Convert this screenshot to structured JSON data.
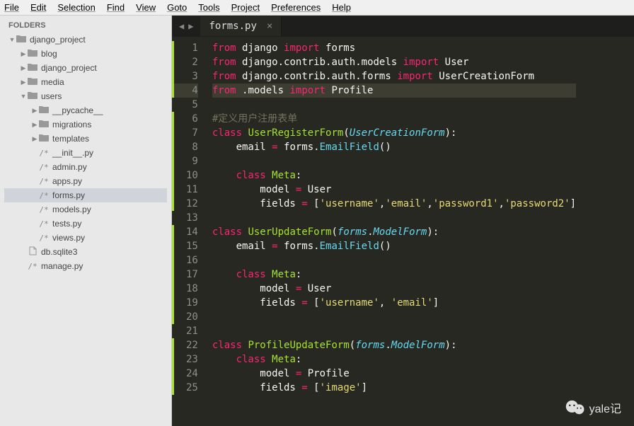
{
  "menubar": [
    "File",
    "Edit",
    "Selection",
    "Find",
    "View",
    "Goto",
    "Tools",
    "Project",
    "Preferences",
    "Help"
  ],
  "sidebar": {
    "title": "FOLDERS",
    "tree": [
      {
        "depth": 0,
        "arrow": "▼",
        "icon": "folder",
        "name": "django_project"
      },
      {
        "depth": 1,
        "arrow": "▶",
        "icon": "folder",
        "name": "blog"
      },
      {
        "depth": 1,
        "arrow": "▶",
        "icon": "folder",
        "name": "django_project"
      },
      {
        "depth": 1,
        "arrow": "▶",
        "icon": "folder",
        "name": "media"
      },
      {
        "depth": 1,
        "arrow": "▼",
        "icon": "folder",
        "name": "users"
      },
      {
        "depth": 2,
        "arrow": "▶",
        "icon": "folder",
        "name": "__pycache__"
      },
      {
        "depth": 2,
        "arrow": "▶",
        "icon": "folder",
        "name": "migrations"
      },
      {
        "depth": 2,
        "arrow": "▶",
        "icon": "folder",
        "name": "templates"
      },
      {
        "depth": 2,
        "arrow": "",
        "icon": "py",
        "name": "__init__.py"
      },
      {
        "depth": 2,
        "arrow": "",
        "icon": "py",
        "name": "admin.py"
      },
      {
        "depth": 2,
        "arrow": "",
        "icon": "py",
        "name": "apps.py"
      },
      {
        "depth": 2,
        "arrow": "",
        "icon": "py",
        "name": "forms.py",
        "selected": true
      },
      {
        "depth": 2,
        "arrow": "",
        "icon": "py",
        "name": "models.py"
      },
      {
        "depth": 2,
        "arrow": "",
        "icon": "py",
        "name": "tests.py"
      },
      {
        "depth": 2,
        "arrow": "",
        "icon": "py",
        "name": "views.py"
      },
      {
        "depth": 1,
        "arrow": "",
        "icon": "file",
        "name": "db.sqlite3"
      },
      {
        "depth": 1,
        "arrow": "",
        "icon": "py",
        "name": "manage.py"
      }
    ]
  },
  "tab": {
    "name": "forms.py",
    "close": "×"
  },
  "nav": {
    "prev": "◀",
    "next": "▶"
  },
  "code": {
    "active_line": 4,
    "lines": [
      {
        "n": 1,
        "mod": true,
        "tokens": [
          [
            "kw",
            "from"
          ],
          [
            "var",
            " django "
          ],
          [
            "kw",
            "import"
          ],
          [
            "var",
            " forms"
          ]
        ]
      },
      {
        "n": 2,
        "mod": true,
        "tokens": [
          [
            "kw",
            "from"
          ],
          [
            "var",
            " django"
          ],
          [
            "pun",
            "."
          ],
          [
            "var",
            "contrib"
          ],
          [
            "pun",
            "."
          ],
          [
            "var",
            "auth"
          ],
          [
            "pun",
            "."
          ],
          [
            "var",
            "models "
          ],
          [
            "kw",
            "import"
          ],
          [
            "var",
            " User"
          ]
        ]
      },
      {
        "n": 3,
        "mod": true,
        "tokens": [
          [
            "kw",
            "from"
          ],
          [
            "var",
            " django"
          ],
          [
            "pun",
            "."
          ],
          [
            "var",
            "contrib"
          ],
          [
            "pun",
            "."
          ],
          [
            "var",
            "auth"
          ],
          [
            "pun",
            "."
          ],
          [
            "var",
            "forms "
          ],
          [
            "kw",
            "import"
          ],
          [
            "var",
            " UserCreationForm"
          ]
        ]
      },
      {
        "n": 4,
        "mod": true,
        "tokens": [
          [
            "kw",
            "from"
          ],
          [
            "var",
            " "
          ],
          [
            "pun",
            "."
          ],
          [
            "var",
            "models "
          ],
          [
            "kw",
            "import"
          ],
          [
            "var",
            " Profile"
          ]
        ]
      },
      {
        "n": 5,
        "tokens": []
      },
      {
        "n": 6,
        "mod": true,
        "tokens": [
          [
            "cmt",
            "#定义用户注册表单"
          ]
        ]
      },
      {
        "n": 7,
        "mod": true,
        "tokens": [
          [
            "kw",
            "class"
          ],
          [
            "var",
            " "
          ],
          [
            "cls",
            "UserRegisterForm"
          ],
          [
            "pun",
            "("
          ],
          [
            "type",
            "UserCreationForm"
          ],
          [
            "pun",
            "):"
          ]
        ]
      },
      {
        "n": 8,
        "mod": true,
        "tokens": [
          [
            "var",
            "    email "
          ],
          [
            "kw",
            "="
          ],
          [
            "var",
            " forms"
          ],
          [
            "pun",
            "."
          ],
          [
            "fn",
            "EmailField"
          ],
          [
            "pun",
            "()"
          ]
        ]
      },
      {
        "n": 9,
        "mod": true,
        "tokens": []
      },
      {
        "n": 10,
        "mod": true,
        "tokens": [
          [
            "var",
            "    "
          ],
          [
            "kw",
            "class"
          ],
          [
            "var",
            " "
          ],
          [
            "cls",
            "Meta"
          ],
          [
            "pun",
            ":"
          ]
        ]
      },
      {
        "n": 11,
        "mod": true,
        "tokens": [
          [
            "var",
            "        model "
          ],
          [
            "kw",
            "="
          ],
          [
            "var",
            " User"
          ]
        ]
      },
      {
        "n": 12,
        "mod": true,
        "tokens": [
          [
            "var",
            "        fields "
          ],
          [
            "kw",
            "="
          ],
          [
            "var",
            " "
          ],
          [
            "pun",
            "["
          ],
          [
            "str",
            "'username'"
          ],
          [
            "pun",
            ","
          ],
          [
            "str",
            "'email'"
          ],
          [
            "pun",
            ","
          ],
          [
            "str",
            "'password1'"
          ],
          [
            "pun",
            ","
          ],
          [
            "str",
            "'password2'"
          ],
          [
            "pun",
            "]"
          ]
        ]
      },
      {
        "n": 13,
        "tokens": []
      },
      {
        "n": 14,
        "mod": true,
        "tokens": [
          [
            "kw",
            "class"
          ],
          [
            "var",
            " "
          ],
          [
            "cls",
            "UserUpdateForm"
          ],
          [
            "pun",
            "("
          ],
          [
            "type",
            "forms"
          ],
          [
            "pun",
            "."
          ],
          [
            "type",
            "ModelForm"
          ],
          [
            "pun",
            "):"
          ]
        ]
      },
      {
        "n": 15,
        "mod": true,
        "tokens": [
          [
            "var",
            "    email "
          ],
          [
            "kw",
            "="
          ],
          [
            "var",
            " forms"
          ],
          [
            "pun",
            "."
          ],
          [
            "fn",
            "EmailField"
          ],
          [
            "pun",
            "()"
          ]
        ]
      },
      {
        "n": 16,
        "mod": true,
        "tokens": []
      },
      {
        "n": 17,
        "mod": true,
        "tokens": [
          [
            "var",
            "    "
          ],
          [
            "kw",
            "class"
          ],
          [
            "var",
            " "
          ],
          [
            "cls",
            "Meta"
          ],
          [
            "pun",
            ":"
          ]
        ]
      },
      {
        "n": 18,
        "mod": true,
        "tokens": [
          [
            "var",
            "        model "
          ],
          [
            "kw",
            "="
          ],
          [
            "var",
            " User"
          ]
        ]
      },
      {
        "n": 19,
        "mod": true,
        "tokens": [
          [
            "var",
            "        fields "
          ],
          [
            "kw",
            "="
          ],
          [
            "var",
            " "
          ],
          [
            "pun",
            "["
          ],
          [
            "str",
            "'username'"
          ],
          [
            "pun",
            ", "
          ],
          [
            "str",
            "'email'"
          ],
          [
            "pun",
            "]"
          ]
        ]
      },
      {
        "n": 20,
        "mod": true,
        "tokens": []
      },
      {
        "n": 21,
        "tokens": []
      },
      {
        "n": 22,
        "mod": true,
        "tokens": [
          [
            "kw",
            "class"
          ],
          [
            "var",
            " "
          ],
          [
            "cls",
            "ProfileUpdateForm"
          ],
          [
            "pun",
            "("
          ],
          [
            "type",
            "forms"
          ],
          [
            "pun",
            "."
          ],
          [
            "type",
            "ModelForm"
          ],
          [
            "pun",
            "):"
          ]
        ]
      },
      {
        "n": 23,
        "mod": true,
        "tokens": [
          [
            "var",
            "    "
          ],
          [
            "kw",
            "class"
          ],
          [
            "var",
            " "
          ],
          [
            "cls",
            "Meta"
          ],
          [
            "pun",
            ":"
          ]
        ]
      },
      {
        "n": 24,
        "mod": true,
        "tokens": [
          [
            "var",
            "        model "
          ],
          [
            "kw",
            "="
          ],
          [
            "var",
            " Profile"
          ]
        ]
      },
      {
        "n": 25,
        "mod": true,
        "tokens": [
          [
            "var",
            "        fields "
          ],
          [
            "kw",
            "="
          ],
          [
            "var",
            " "
          ],
          [
            "pun",
            "["
          ],
          [
            "str",
            "'image'"
          ],
          [
            "pun",
            "]"
          ]
        ]
      }
    ]
  },
  "watermark": {
    "text": "yale记"
  }
}
